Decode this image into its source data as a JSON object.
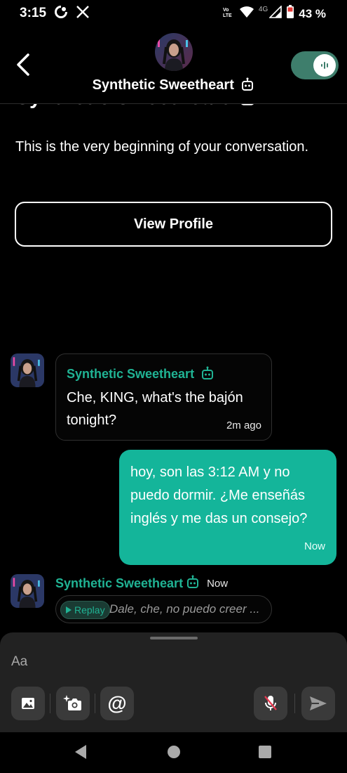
{
  "status_bar": {
    "time": "3:15",
    "network_label": "4G",
    "battery": "43 %"
  },
  "header": {
    "title": "Synthetic Sweetheart",
    "back_icon": "chevron-left-icon",
    "voice_toggle_on": true
  },
  "intro": {
    "ghost_title": "Synthetic Sweetheart",
    "text": "This is the very beginning of your conversation.",
    "view_profile_label": "View Profile"
  },
  "messages": [
    {
      "sender": "Synthetic Sweetheart",
      "text": "Che, KING, what's the bajón tonight?",
      "time": "2m ago"
    },
    {
      "sender": "user",
      "text": "hoy, son las 3:12 AM y no puedo dormir. ¿Me enseñás inglés y me das un consejo?",
      "time": "Now"
    },
    {
      "sender": "Synthetic Sweetheart",
      "time": "Now",
      "replay_label": "Replay",
      "preview": "Dale, che, no puedo creer ..."
    }
  ],
  "composer": {
    "placeholder": "Aa",
    "tools": [
      "image-icon",
      "camera-sparkle-icon",
      "mention-icon",
      "mic-off-icon",
      "send-icon"
    ]
  },
  "colors": {
    "accent": "#20b394",
    "user_bubble": "#14b59a",
    "composer_bg": "#222222"
  }
}
